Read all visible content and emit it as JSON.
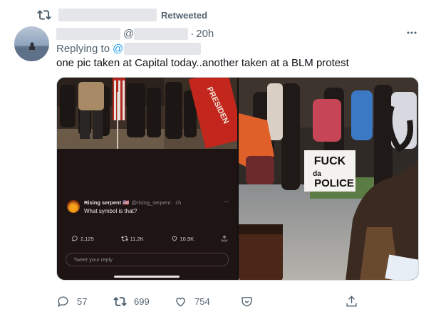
{
  "retweet_header": {
    "label": "Retweeted",
    "icon": "retweet-icon"
  },
  "tweet": {
    "time": "20h",
    "handle_prefix": "@",
    "dot": "·",
    "reply_label": "Replying to",
    "reply_handle_prefix": "@",
    "text": "one pic taken at Capital today..another taken at a BLM protest"
  },
  "media": {
    "left_image": {
      "flag_text": "PRESIDEN",
      "embedded_tweet": {
        "name": "Rising serpent 🇺🇸",
        "handle_time": "@rising_serpent · 1h",
        "text": "What symbol is that?",
        "more": "···",
        "replies": "2,125",
        "retweets": "11.2K",
        "likes": "10.9K",
        "reply_placeholder": "Tweet your reply"
      }
    },
    "right_image": {
      "sign_text_line1": "FUCK",
      "sign_text_line2": "da",
      "sign_text_line3": "POLICE"
    }
  },
  "actions": {
    "replies": "57",
    "retweets": "699",
    "likes": "754"
  },
  "colors": {
    "text_primary": "#0f1419",
    "text_secondary": "#536471",
    "link": "#1d9bf0",
    "border": "#cfd9de"
  }
}
